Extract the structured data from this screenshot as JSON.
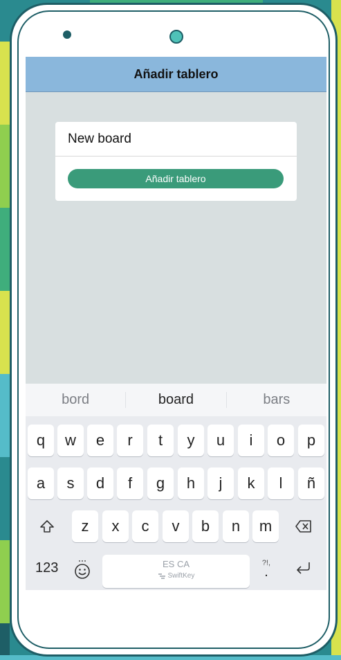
{
  "header": {
    "title": "Añadir tablero"
  },
  "board_form": {
    "name_value": "New board",
    "submit_label": "Añadir tablero"
  },
  "suggestions": [
    "bord",
    "board",
    "bars"
  ],
  "keyboard": {
    "row1": [
      "q",
      "w",
      "e",
      "r",
      "t",
      "y",
      "u",
      "i",
      "o",
      "p"
    ],
    "row2": [
      "a",
      "s",
      "d",
      "f",
      "g",
      "h",
      "j",
      "k",
      "l",
      "ñ"
    ],
    "row3": [
      "z",
      "x",
      "c",
      "v",
      "b",
      "n",
      "m"
    ],
    "numbers_label": "123",
    "space_language": "ES CA",
    "space_brand": "SwiftKey",
    "punct_label": "?!,",
    "punct_dot": "."
  },
  "colors": {
    "header_bg": "#8ab7dc",
    "button_bg": "#3a9b7a",
    "screen_bg": "#d8dfe0"
  }
}
